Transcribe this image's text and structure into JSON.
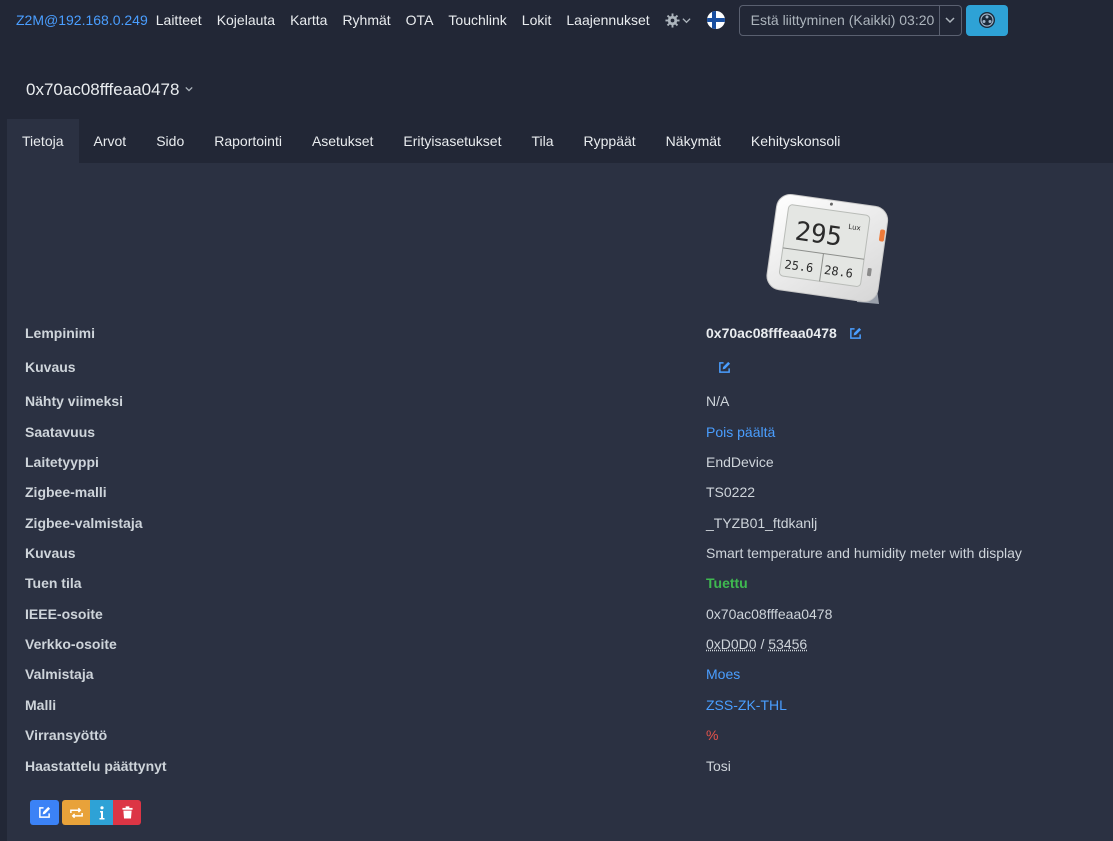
{
  "navbar": {
    "brand": "Z2M@192.168.0.249",
    "links": [
      "Laitteet",
      "Kojelauta",
      "Kartta",
      "Ryhmät",
      "OTA",
      "Touchlink",
      "Lokit",
      "Laajennukset"
    ],
    "settings_icon": "gear-icon",
    "language_flag": "finland-flag-icon",
    "permit_join_label": "Estä liittyminen (Kaikki) 03:20",
    "permit_join_dropdown_icon": "chevron-down-icon",
    "join_icon": "zigbee-icon"
  },
  "device": {
    "title": "0x70ac08fffeaa0478"
  },
  "tabs": [
    "Tietoja",
    "Arvot",
    "Sido",
    "Raportointi",
    "Asetukset",
    "Erityisasetukset",
    "Tila",
    "Ryppäät",
    "Näkymät",
    "Kehityskonsoli"
  ],
  "active_tab": "Tietoja",
  "info": [
    {
      "label": "Lempinimi",
      "value": "0x70ac08fffeaa0478"
    },
    {
      "label": "Kuvaus",
      "value": ""
    },
    {
      "label": "Nähty viimeksi",
      "value": "N/A"
    },
    {
      "label": "Saatavuus",
      "value": "Pois päältä"
    },
    {
      "label": "Laitetyyppi",
      "value": "EndDevice"
    },
    {
      "label": "Zigbee-malli",
      "value": "TS0222"
    },
    {
      "label": "Zigbee-valmistaja",
      "value": "_TYZB01_ftdkanlj"
    },
    {
      "label": "Kuvaus",
      "value": "Smart temperature and humidity meter with display"
    },
    {
      "label": "Tuen tila",
      "value": "Tuettu"
    },
    {
      "label": "IEEE-osoite",
      "value": "0x70ac08fffeaa0478"
    },
    {
      "label": "Verkko-osoite",
      "value_hex": "0xD0D0",
      "value_sep": " / ",
      "value_dec": "53456"
    },
    {
      "label": "Valmistaja",
      "value": "Moes"
    },
    {
      "label": "Malli",
      "value": "ZSS-ZK-THL"
    },
    {
      "label": "Virransyöttö",
      "value": "%"
    },
    {
      "label": "Haastattelu päättynyt",
      "value": "Tosi"
    }
  ],
  "device_display": {
    "lux": "295",
    "lux_unit": "Lux",
    "temp": "25.6",
    "humidity": "28.6"
  },
  "colors": {
    "accent": "#4a9eff",
    "background": "#222736",
    "panel": "#2b3142",
    "supported": "#3fb950",
    "power": "#e5534b"
  },
  "actions": [
    "edit-icon",
    "reconfigure-icon",
    "info-icon",
    "trash-icon"
  ]
}
